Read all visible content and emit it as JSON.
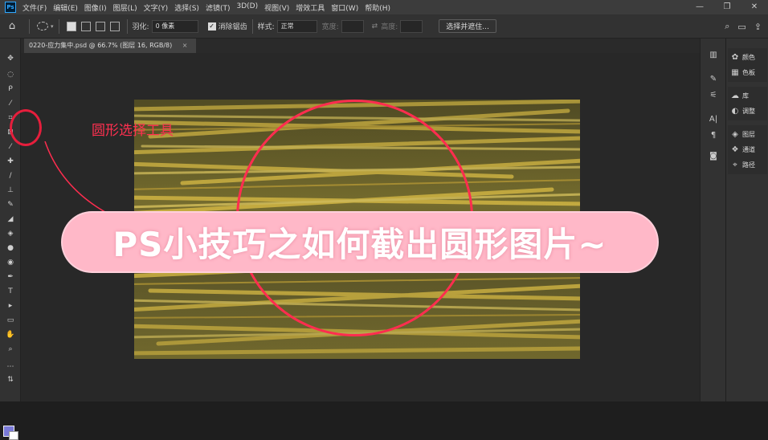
{
  "menubar": {
    "logo": "Ps",
    "items": [
      "文件(F)",
      "编辑(E)",
      "图像(I)",
      "图层(L)",
      "文字(Y)",
      "选择(S)",
      "滤镜(T)",
      "3D(D)",
      "视图(V)",
      "增效工具",
      "窗口(W)",
      "帮助(H)"
    ],
    "controls": {
      "minimize": "—",
      "restore": "❐",
      "close": "✕"
    }
  },
  "options": {
    "feather_label": "羽化:",
    "feather_value": "0 像素",
    "antialias_label": "消除锯齿",
    "style_label": "样式:",
    "style_value": "正常",
    "width_label": "宽度:",
    "height_label": "高度:",
    "select_mask_button": "选择并遮住..."
  },
  "document": {
    "tab_title": "0220-应力集中.psd @ 66.7% (图层 16, RGB/8)",
    "tab_close": "×"
  },
  "annotation": {
    "tool_label": "圆形选择工具"
  },
  "banner": {
    "text": "PS小技巧之如何截出圆形图片~"
  },
  "panels": {
    "group1": [
      {
        "icon": "palette-icon",
        "label": "颜色"
      },
      {
        "icon": "grid-icon",
        "label": "色板"
      }
    ],
    "group2": [
      {
        "icon": "cloud-icon",
        "label": "库"
      },
      {
        "icon": "adjust-icon",
        "label": "调整"
      }
    ],
    "group3": [
      {
        "icon": "layers-icon",
        "label": "图层"
      },
      {
        "icon": "channels-icon",
        "label": "通道"
      },
      {
        "icon": "paths-icon",
        "label": "路径"
      }
    ]
  },
  "colors": {
    "accent_red": "#ff2d4f",
    "banner_pink": "#ffb8c8",
    "ui_dark": "#323232"
  }
}
